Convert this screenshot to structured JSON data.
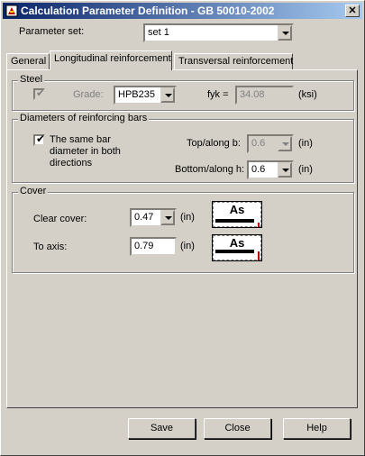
{
  "window": {
    "title": "Calculation Parameter Definition - GB 50010-2002",
    "close_glyph": "✕"
  },
  "parameter_set": {
    "label": "Parameter set:",
    "value": "set 1"
  },
  "tabs": [
    {
      "label": "General",
      "active": false
    },
    {
      "label": "Longitudinal reinforcement",
      "active": true
    },
    {
      "label": "Transversal reinforcement",
      "active": false
    }
  ],
  "steel": {
    "legend": "Steel",
    "grade_label": "Grade:",
    "grade_value": "HPB235",
    "fyk_label": "fyk =",
    "fyk_value": "34.08",
    "fyk_unit": "(ksi)",
    "checkbox_checked": true
  },
  "diameters": {
    "legend": "Diameters of reinforcing bars",
    "same_bar_label": "The same bar diameter in both directions",
    "same_bar_checked": true,
    "top_label": "Top/along b:",
    "top_value": "0.6",
    "top_unit": "(in)",
    "bottom_label": "Bottom/along h:",
    "bottom_value": "0.6",
    "bottom_unit": "(in)"
  },
  "cover": {
    "legend": "Cover",
    "clear_label": "Clear cover:",
    "clear_value": "0.47",
    "clear_unit": "(in)",
    "axis_label": "To axis:",
    "axis_value": "0.79",
    "axis_unit": "(in)",
    "diagram_text": "As"
  },
  "buttons": {
    "save": "Save",
    "close": "Close",
    "help": "Help"
  }
}
